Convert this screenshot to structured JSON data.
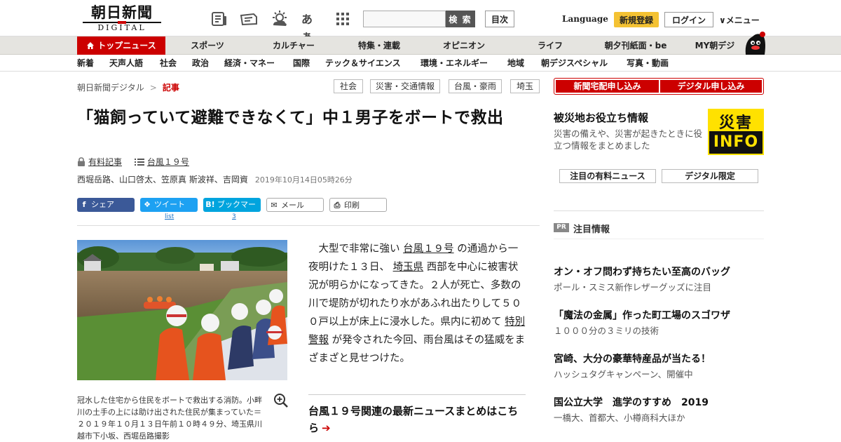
{
  "header": {
    "logo_ja": "朝日新聞",
    "logo_en": "DIGITAL",
    "font_toggle": "あぁ",
    "search_placeholder": "",
    "search_button": "検 索",
    "toc_button": "目次",
    "language": "Language",
    "signup": "新規登録",
    "login": "ログイン",
    "menu": "∨メニュー"
  },
  "gnav": {
    "items": [
      "トップニュース",
      "スポーツ",
      "カルチャー",
      "特集・連載",
      "オピニオン",
      "ライフ",
      "朝夕刊紙面・be",
      "MY朝デジ"
    ]
  },
  "snav": {
    "items": [
      "新着",
      "天声人語",
      "社会",
      "政治",
      "経済・マネー",
      "国際",
      "テック＆サイエンス",
      "環境・エネルギー",
      "地域",
      "朝デジスペシャル",
      "写真・動画"
    ]
  },
  "breadcrumb": {
    "home": "朝日新聞デジタル",
    "sep": ">",
    "current": "記事"
  },
  "tags": [
    "社会",
    "災害・交通情報",
    "台風・豪雨",
    "埼玉"
  ],
  "article": {
    "title": "「猫飼っていて避難できなくて」中１男子をボートで救出",
    "paid_label": "有料記事",
    "series_label": "台風１９号",
    "authors": "西堀岳路、山口啓太、笠原真 斯波祥、吉岡資",
    "date": "2019年10月14日05時26分",
    "share": {
      "facebook": "シェア",
      "twitter": "ツイート",
      "hatena": "ブックマーク",
      "mail": "メール",
      "print": "印刷",
      "twitter_count": "list",
      "hatena_count": "3"
    },
    "photo_caption": "冠水した住宅から住民をボートで救出する消防。小畔川の土手の上には助け出された住民が集まっていた＝２０１９年１０月１３日午前１０時４９分、埼玉県川越市下小坂、西堀岳路撮影",
    "lead": {
      "p1": "大型で非常に強い",
      "kw1": "台風１９号",
      "p2": "の通過から一夜明けた１３日、",
      "kw2": "埼玉県",
      "p3": "西部を中心に被害状況が明らかになってきた。２人が死亡、多数の川で堤防が切れたり水があふれ出たりして５００戸以上が床上に浸水した。県内に初めて",
      "kw3": "特別警報",
      "p4": "が発令された今回、雨台風はその猛威をまざまざと見せつけた。"
    },
    "related_link": "台風１９号関連の最新ニュースまとめはこちら"
  },
  "sidebar": {
    "subscribe_newspaper": "新聞宅配申し込み",
    "subscribe_digital": "デジタル申し込み",
    "disaster_title": "被災地お役立ち情報",
    "disaster_desc": "災害の備えや、災害が起きたときに役立つ情報をまとめました",
    "disaster_badge_ja": "災害",
    "disaster_badge_en": "INFO",
    "tab_paid": "注目の有料ニュース",
    "tab_digital": "デジタル限定",
    "pr_badge": "PR",
    "pr_heading": "注目情報",
    "pr_items": [
      {
        "title": "オン・オフ問わず持ちたい至高のバッグ",
        "sub": "ポール・スミス新作レザーグッズに注目"
      },
      {
        "title": "「魔法の金属」作った町工場のスゴワザ",
        "sub": "１０００分の３ミリの技術"
      },
      {
        "title": "宮崎、大分の豪華特産品が当たる！",
        "sub": "ハッシュタグキャンペーン、開催中"
      },
      {
        "title": "国公立大学　進学のすすめ　2019",
        "sub": "一橋大、首都大、小樽商科大ほか"
      }
    ]
  },
  "colors": {
    "brand_red": "#cc0000",
    "signup_yellow": "#f4c233",
    "disaster_yellow": "#ffe100"
  }
}
